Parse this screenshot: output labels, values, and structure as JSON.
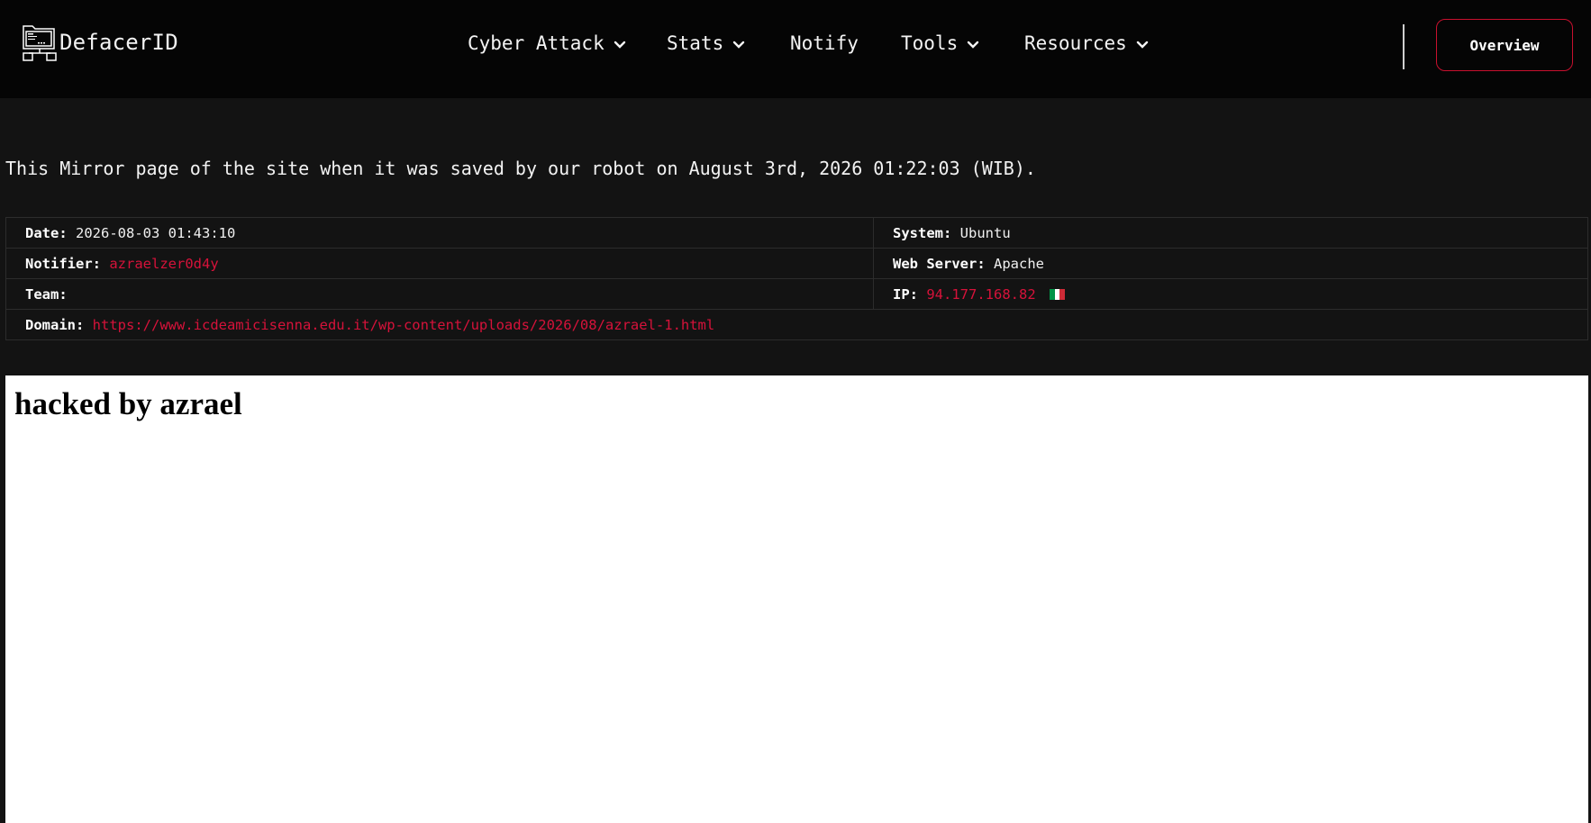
{
  "header": {
    "logo_text": "DefacerID",
    "nav": [
      {
        "label": "Cyber Attack",
        "has_dropdown": true
      },
      {
        "label": "Stats",
        "has_dropdown": true
      },
      {
        "label": "Notify",
        "has_dropdown": false
      },
      {
        "label": "Tools",
        "has_dropdown": true
      },
      {
        "label": "Resources",
        "has_dropdown": true
      }
    ],
    "overview_label": "Overview"
  },
  "mirror_note": "This Mirror page of the site when it was saved by our robot on August 3rd, 2026 01:22:03 (WIB).",
  "info": {
    "date_label": "Date:",
    "date_value": "2026-08-03 01:43:10",
    "system_label": "System:",
    "system_value": "Ubuntu",
    "notifier_label": "Notifier:",
    "notifier_value": "azraelzer0d4y",
    "webserver_label": "Web Server:",
    "webserver_value": "Apache",
    "team_label": "Team:",
    "team_value": "",
    "ip_label": "IP:",
    "ip_value": "94.177.168.82",
    "ip_flag_icon": "italy-flag-icon",
    "domain_label": "Domain:",
    "domain_value": "https://www.icdeamicisenna.edu.it/wp-content/uploads/2026/08/azrael-1.html"
  },
  "mirror_content": {
    "heading": "hacked by azrael"
  },
  "colors": {
    "accent_red": "#d6123a",
    "header_bg": "#050505",
    "page_bg": "#131313"
  }
}
